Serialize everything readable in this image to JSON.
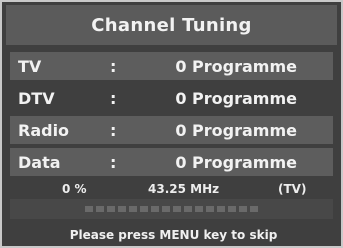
{
  "dialog": {
    "title": "Channel Tuning"
  },
  "rows": [
    {
      "label": "TV",
      "colon": ":",
      "value": "0 Programme"
    },
    {
      "label": "DTV",
      "colon": ":",
      "value": "0 Programme"
    },
    {
      "label": "Radio",
      "colon": ":",
      "value": "0 Programme"
    },
    {
      "label": "Data",
      "colon": ":",
      "value": "0 Programme"
    }
  ],
  "status": {
    "percent": "0  %",
    "frequency": "43.25 MHz",
    "mode": "(TV)"
  },
  "progress": {
    "fraction": 0.0,
    "segments": 16
  },
  "hint": "Please press MENU key to skip",
  "colors": {
    "background": "#3f3f3f",
    "title_bar": "#5b5b5b",
    "row_highlight": "#5d5d5d",
    "text": "#f2f2f2",
    "segment": "#6a6a6a"
  }
}
